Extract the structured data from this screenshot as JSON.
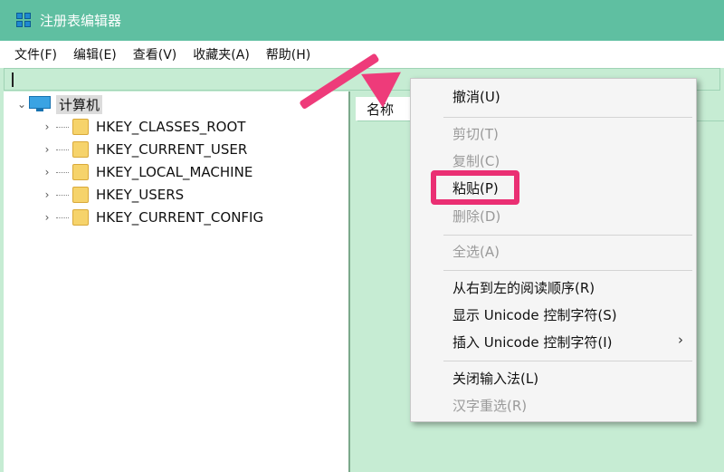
{
  "window": {
    "title": "注册表编辑器"
  },
  "menubar": {
    "items": [
      "文件(F)",
      "编辑(E)",
      "查看(V)",
      "收藏夹(A)",
      "帮助(H)"
    ]
  },
  "address": {
    "value": ""
  },
  "tree": {
    "root_label": "计算机",
    "items": [
      "HKEY_CLASSES_ROOT",
      "HKEY_CURRENT_USER",
      "HKEY_LOCAL_MACHINE",
      "HKEY_USERS",
      "HKEY_CURRENT_CONFIG"
    ]
  },
  "list": {
    "column_name": "名称"
  },
  "context_menu": {
    "undo": "撤消(U)",
    "cut": "剪切(T)",
    "copy": "复制(C)",
    "paste": "粘贴(P)",
    "delete": "删除(D)",
    "select_all": "全选(A)",
    "rtl": "从右到左的阅读顺序(R)",
    "show_unicode": "显示 Unicode 控制字符(S)",
    "insert_unicode": "插入 Unicode 控制字符(I)",
    "submenu_arrow": "›",
    "close_ime": "关闭输入法(L)",
    "reconversion": "汉字重选(R)"
  },
  "colors": {
    "titlebar": "#5fbfa1",
    "pane": "#c6ecd3",
    "annotation": "#ea2f73"
  }
}
